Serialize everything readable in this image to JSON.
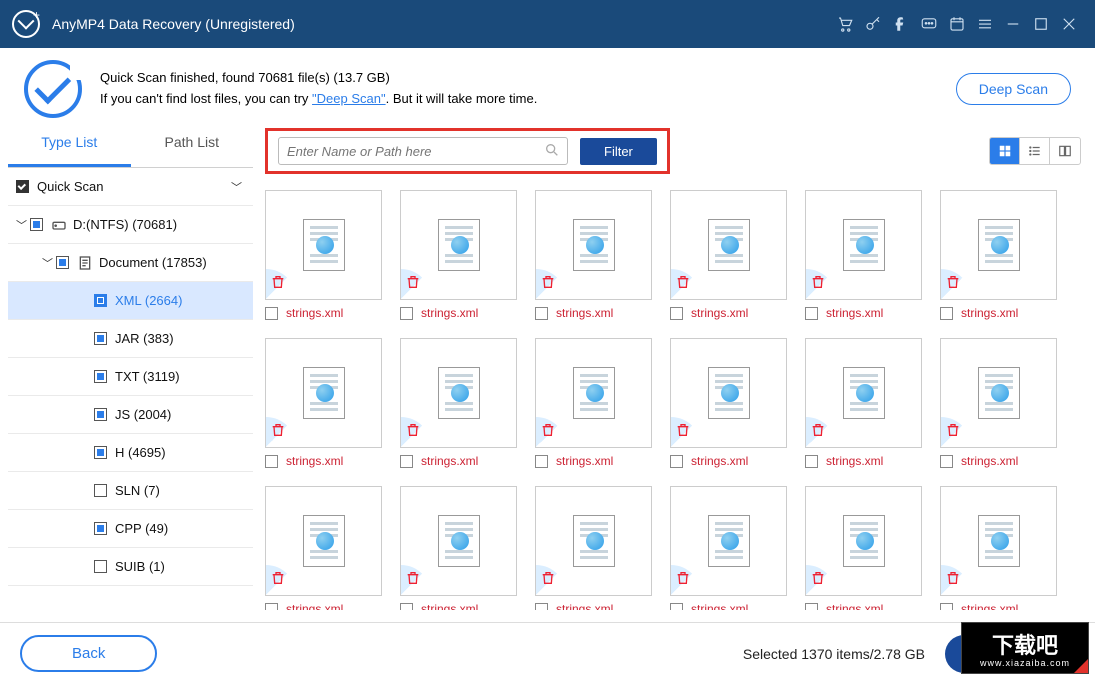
{
  "titlebar": {
    "title": "AnyMP4 Data Recovery (Unregistered)"
  },
  "status": {
    "line1_a": "Quick Scan finished, found ",
    "files_count": "70681",
    "line1_b": " file(s) ",
    "size": "(13.7 GB)",
    "line2_a": "If you can't find lost files, you can try ",
    "deep_link": "\"Deep Scan\"",
    "line2_b": ". But it will take more time.",
    "deep_scan_btn": "Deep Scan"
  },
  "tabs": {
    "type_list": "Type List",
    "path_list": "Path List"
  },
  "tree": {
    "quick_scan": "Quick Scan",
    "drive": "D:(NTFS) (70681)",
    "document": "Document (17853)",
    "items": [
      {
        "label": "XML (2664)",
        "checked": "full",
        "selected": true
      },
      {
        "label": "JAR (383)",
        "checked": "part"
      },
      {
        "label": "TXT (3119)",
        "checked": "part"
      },
      {
        "label": "JS (2004)",
        "checked": "part"
      },
      {
        "label": "H (4695)",
        "checked": "part"
      },
      {
        "label": "SLN (7)",
        "checked": "none"
      },
      {
        "label": "CPP (49)",
        "checked": "part"
      },
      {
        "label": "SUIB (1)",
        "checked": "none"
      }
    ]
  },
  "search": {
    "placeholder": "Enter Name or Path here",
    "filter_btn": "Filter"
  },
  "files": [
    "strings.xml",
    "strings.xml",
    "strings.xml",
    "strings.xml",
    "strings.xml",
    "strings.xml",
    "strings.xml",
    "strings.xml",
    "strings.xml",
    "strings.xml",
    "strings.xml",
    "strings.xml",
    "strings.xml",
    "strings.xml",
    "strings.xml",
    "strings.xml",
    "strings.xml",
    "strings.xml"
  ],
  "footer": {
    "back": "Back",
    "selected": "Selected 1370 items/2.78 GB"
  },
  "watermark": {
    "main": "下载吧",
    "sub": "www.xiazaiba.com"
  }
}
